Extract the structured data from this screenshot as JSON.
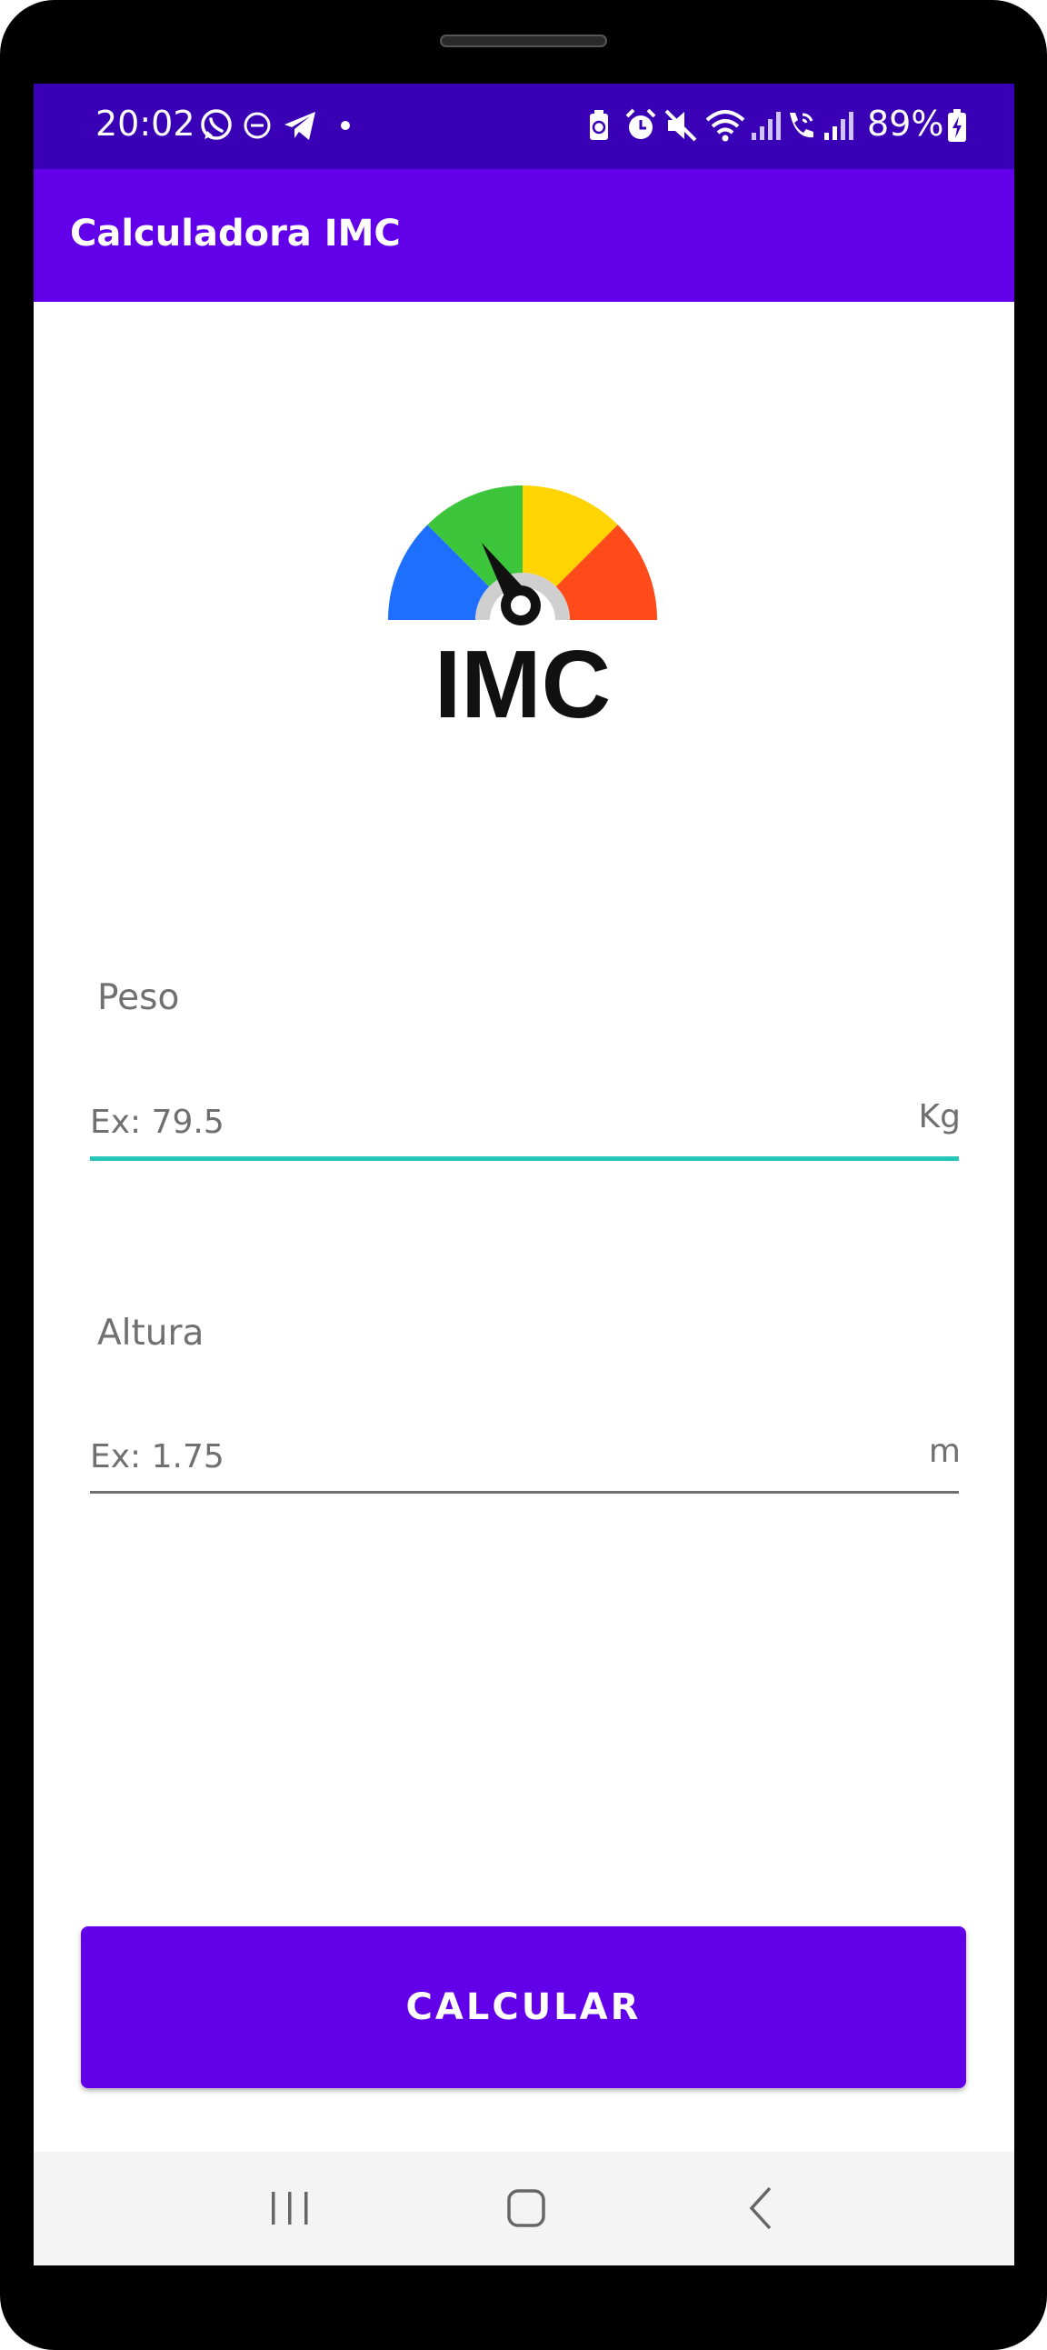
{
  "status_bar": {
    "time": "20:02",
    "battery": "89%",
    "left_icons": [
      "whatsapp-icon",
      "dnd-icon",
      "telegram-icon",
      "dot-icon"
    ],
    "right_icons": [
      "battery-saver-icon",
      "alarm-icon",
      "mute-icon",
      "wifi-icon",
      "signal-icon",
      "wifi-call-icon",
      "signal-icon",
      "battery-charging-icon"
    ]
  },
  "app_bar": {
    "title": "Calculadora IMC"
  },
  "logo": {
    "text": "IMC",
    "colors": [
      "#1e6fff",
      "#3cc43a",
      "#ffd400",
      "#ff4a1a"
    ]
  },
  "form": {
    "peso": {
      "label": "Peso",
      "placeholder": "Ex: 79.5",
      "value": "",
      "unit": "Kg"
    },
    "altura": {
      "label": "Altura",
      "placeholder": "Ex: 1.75",
      "value": "",
      "unit": "m"
    }
  },
  "button": {
    "label": "CALCULAR"
  },
  "nav_bar": {
    "buttons": [
      "recents-icon",
      "home-icon",
      "back-icon"
    ]
  },
  "colors": {
    "status_bar": "#3a00b6",
    "primary": "#6200ea",
    "focus_line": "#26c6b9"
  }
}
